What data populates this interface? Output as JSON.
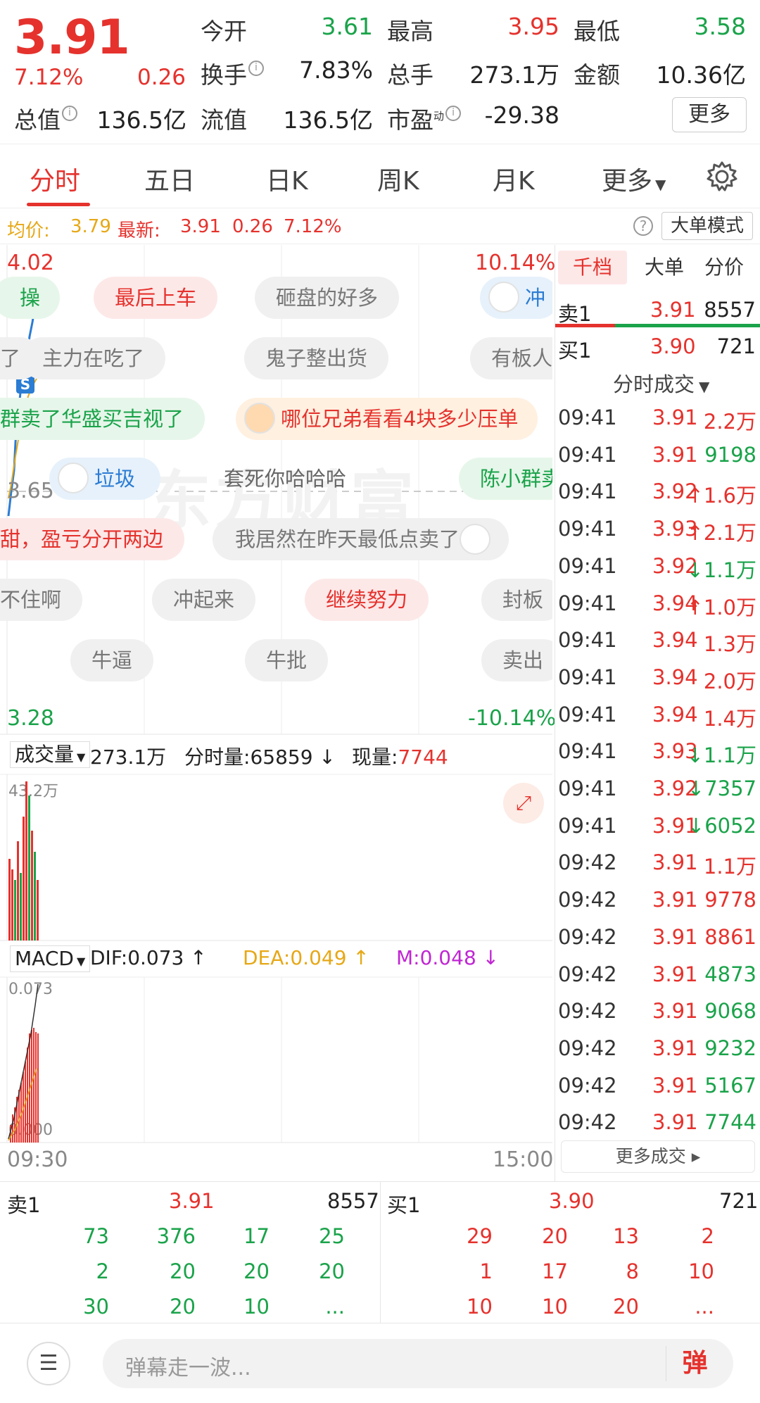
{
  "quote": {
    "price": "3.91",
    "change_pct": "7.12%",
    "change": "0.26",
    "open_label": "今开",
    "open": "3.61",
    "high_label": "最高",
    "high": "3.95",
    "low_label": "最低",
    "low": "3.58",
    "turnover_label": "换手",
    "turnover": "7.83%",
    "volume_label": "总手",
    "volume": "273.1万",
    "amount_label": "金额",
    "amount": "10.36亿",
    "mktcap_label": "总值",
    "mktcap": "136.5亿",
    "float_label": "流值",
    "float": "136.5亿",
    "pe_label": "市盈",
    "pe_sup": "动",
    "pe": "-29.38",
    "more_label": "更多"
  },
  "tabs": [
    "分时",
    "五日",
    "日K",
    "周K",
    "月K",
    "更多"
  ],
  "avg_bar": {
    "avg_label": "均价:",
    "avg": "3.79",
    "latest_label": "最新:",
    "latest": "3.91",
    "change": "0.26",
    "change_pct": "7.12%",
    "big_order_label": "大单模式"
  },
  "chart": {
    "y_top": "4.02",
    "y_mid": "3.65",
    "y_bottom": "3.28",
    "pct_top": "10.14%",
    "pct_bottom": "-10.14%",
    "watermark": "东方财富"
  },
  "danmu": [
    {
      "text": "操",
      "style": "green"
    },
    {
      "text": "最后上车",
      "style": "red"
    },
    {
      "text": "砸盘的好多",
      "style": "gray"
    },
    {
      "text": "冲",
      "style": "blue"
    },
    {
      "text": "了",
      "style": "gray"
    },
    {
      "text": "主力在吃了",
      "style": "gray"
    },
    {
      "text": "鬼子整出货",
      "style": "gray"
    },
    {
      "text": "有板人",
      "style": "gray"
    },
    {
      "text": "群卖了华盛买吉视了",
      "style": "green"
    },
    {
      "text": "哪位兄弟看看4块多少压单",
      "style": "orange"
    },
    {
      "text": "垃圾",
      "style": "blue"
    },
    {
      "text": "套死你哈哈哈",
      "style": "plain"
    },
    {
      "text": "陈小群卖",
      "style": "green"
    },
    {
      "text": "甜，盈亏分开两边",
      "style": "red"
    },
    {
      "text": "我居然在昨天最低点卖了",
      "style": "gray"
    },
    {
      "text": "不住啊",
      "style": "gray"
    },
    {
      "text": "冲起来",
      "style": "gray"
    },
    {
      "text": "继续努力",
      "style": "red"
    },
    {
      "text": "封板",
      "style": "gray"
    },
    {
      "text": "牛逼",
      "style": "gray"
    },
    {
      "text": "牛批",
      "style": "gray"
    },
    {
      "text": "卖出",
      "style": "gray"
    }
  ],
  "volume_bar": {
    "label": "成交量",
    "total": "273.1万",
    "minute_label": "分时量:",
    "minute": "65859",
    "now_label": "现量:",
    "now": "7744",
    "axis_max": "43.2万"
  },
  "macd_bar": {
    "label": "MACD",
    "dif_label": "DIF:",
    "dif": "0.073",
    "dea_label": "DEA:",
    "dea": "0.049",
    "m_label": "M:",
    "m": "0.048",
    "axis_max": "0.073",
    "axis_min": "0.000"
  },
  "time_axis": {
    "start": "09:30",
    "end": "15:00"
  },
  "trades_panel": {
    "tabs": [
      "千档",
      "大单",
      "分价"
    ],
    "ask1_label": "卖1",
    "ask1_price": "3.91",
    "ask1_vol": "8557",
    "bid1_label": "买1",
    "bid1_price": "3.90",
    "bid1_vol": "721",
    "ticks_title": "分时成交",
    "ticks": [
      {
        "time": "09:41",
        "price": "3.91",
        "vol": "2.2万",
        "arrow": "",
        "color": "red",
        "volcolor": "red"
      },
      {
        "time": "09:41",
        "price": "3.91",
        "vol": "9198",
        "arrow": "",
        "color": "red",
        "volcolor": "green"
      },
      {
        "time": "09:41",
        "price": "3.92",
        "vol": "1.6万",
        "arrow": "↑",
        "color": "red",
        "volcolor": "red"
      },
      {
        "time": "09:41",
        "price": "3.93",
        "vol": "2.1万",
        "arrow": "↑",
        "color": "red",
        "volcolor": "red"
      },
      {
        "time": "09:41",
        "price": "3.92",
        "vol": "1.1万",
        "arrow": "↓",
        "color": "red",
        "volcolor": "green"
      },
      {
        "time": "09:41",
        "price": "3.94",
        "vol": "1.0万",
        "arrow": "↑",
        "color": "red",
        "volcolor": "red"
      },
      {
        "time": "09:41",
        "price": "3.94",
        "vol": "1.3万",
        "arrow": "",
        "color": "red",
        "volcolor": "red"
      },
      {
        "time": "09:41",
        "price": "3.94",
        "vol": "2.0万",
        "arrow": "",
        "color": "red",
        "volcolor": "red"
      },
      {
        "time": "09:41",
        "price": "3.94",
        "vol": "1.4万",
        "arrow": "",
        "color": "red",
        "volcolor": "red"
      },
      {
        "time": "09:41",
        "price": "3.93",
        "vol": "1.1万",
        "arrow": "↓",
        "color": "red",
        "volcolor": "green"
      },
      {
        "time": "09:41",
        "price": "3.92",
        "vol": "7357",
        "arrow": "↓",
        "color": "red",
        "volcolor": "green"
      },
      {
        "time": "09:41",
        "price": "3.91",
        "vol": "6052",
        "arrow": "↓",
        "color": "red",
        "volcolor": "green"
      },
      {
        "time": "09:42",
        "price": "3.91",
        "vol": "1.1万",
        "arrow": "",
        "color": "red",
        "volcolor": "red"
      },
      {
        "time": "09:42",
        "price": "3.91",
        "vol": "9778",
        "arrow": "",
        "color": "red",
        "volcolor": "red"
      },
      {
        "time": "09:42",
        "price": "3.91",
        "vol": "8861",
        "arrow": "",
        "color": "red",
        "volcolor": "red"
      },
      {
        "time": "09:42",
        "price": "3.91",
        "vol": "4873",
        "arrow": "",
        "color": "red",
        "volcolor": "green"
      },
      {
        "time": "09:42",
        "price": "3.91",
        "vol": "9068",
        "arrow": "",
        "color": "red",
        "volcolor": "green"
      },
      {
        "time": "09:42",
        "price": "3.91",
        "vol": "9232",
        "arrow": "",
        "color": "red",
        "volcolor": "green"
      },
      {
        "time": "09:42",
        "price": "3.91",
        "vol": "5167",
        "arrow": "",
        "color": "red",
        "volcolor": "green"
      },
      {
        "time": "09:42",
        "price": "3.91",
        "vol": "7744",
        "arrow": "",
        "color": "red",
        "volcolor": "green"
      }
    ],
    "more_trades": "更多成交"
  },
  "order_book": {
    "ask_label": "卖1",
    "ask_price": "3.91",
    "ask_vol": "8557",
    "bid_label": "买1",
    "bid_price": "3.90",
    "bid_vol": "721",
    "ask_rows": [
      [
        "73",
        "376",
        "17",
        "25"
      ],
      [
        "2",
        "20",
        "20",
        "20"
      ],
      [
        "30",
        "20",
        "10",
        "..."
      ]
    ],
    "bid_rows": [
      [
        "29",
        "20",
        "13",
        "2"
      ],
      [
        "1",
        "17",
        "8",
        "10"
      ],
      [
        "10",
        "10",
        "20",
        "..."
      ]
    ]
  },
  "bottom_bar": {
    "input_placeholder": "弹幕走一波...",
    "send_label": "弹"
  },
  "colors": {
    "up": "#e5322d",
    "down": "#1aa34a",
    "avg": "#e6a817",
    "price_line": "#2b7cd3",
    "macd_dea": "#e6a817",
    "macd_m": "#c026d3"
  }
}
